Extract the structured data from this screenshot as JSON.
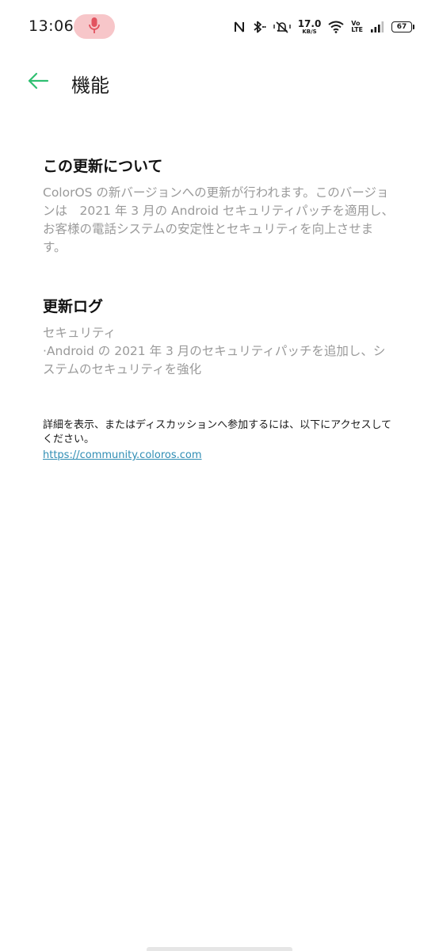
{
  "status_bar": {
    "time": "13:06",
    "net_speed_value": "17.0",
    "net_speed_unit": "KB/S",
    "volte_top": "Vo",
    "volte_bottom": "LTE",
    "battery": "67",
    "icons": [
      "mic-icon",
      "nfc-icon",
      "bluetooth-icon",
      "mute-icon",
      "wifi-icon",
      "signal-icon"
    ],
    "mic_pill_color": "#f7c6c9",
    "mic_icon_color": "#e2535f"
  },
  "app_bar": {
    "title": "機能",
    "back_icon": "arrow-left-icon",
    "accent_color": "#2fbf71"
  },
  "about": {
    "title": "この更新について",
    "body": "ColorOS の新バージョンへの更新が行われます。このバージョンは　2021 年 3 月の Android セキュリティパッチを適用し、お客様の電話システムの安定性とセキュリティを向上させます。"
  },
  "changelog": {
    "title": "更新ログ",
    "body": "セキュリティ\n·Android の 2021 年 3 月のセキュリティパッチを追加し、システムのセキュリティを強化"
  },
  "footer": {
    "text": "詳細を表示、またはディスカッションへ参加するには、以下にアクセスしてください。",
    "link": "https://community.coloros.com",
    "link_color": "#2f8db4"
  }
}
